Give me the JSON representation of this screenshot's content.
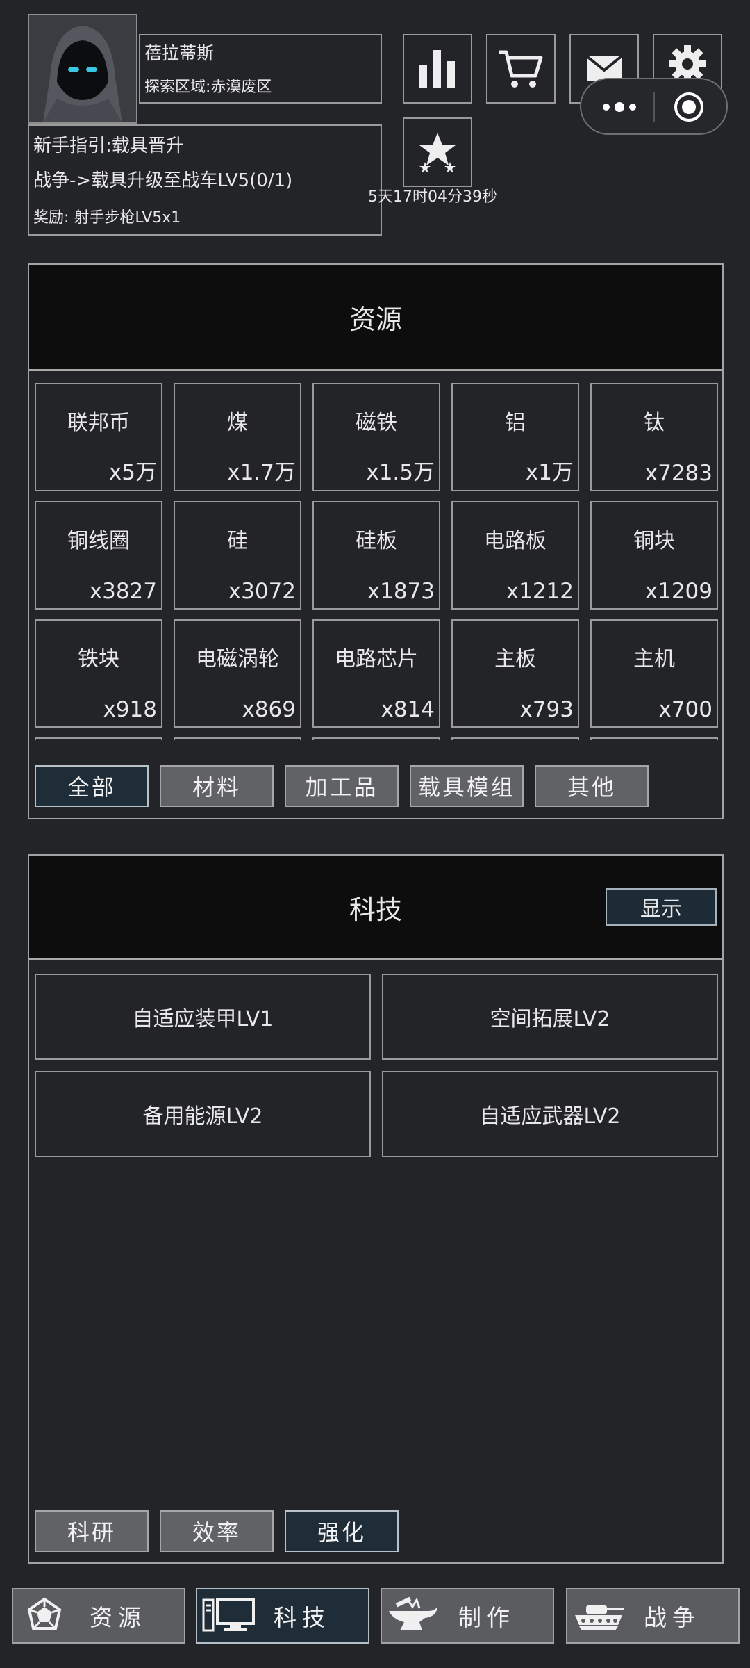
{
  "player": {
    "name": "蓓拉蒂斯",
    "region": "探索区域:赤漠废区"
  },
  "guide": {
    "title": "新手指引:载具晋升",
    "task": "战争->载具升级至战车LV5(0/1)",
    "reward": "奖励: 射手步枪LV5x1"
  },
  "toolbar": {
    "icons": [
      "stats-icon",
      "cart-icon",
      "mail-icon",
      "gear-icon",
      "star-icon"
    ],
    "timer": "5天17时04分39秒"
  },
  "capsule": {
    "icons": [
      "more-dots-icon",
      "record-target-icon"
    ]
  },
  "resources": {
    "title": "资源",
    "items": [
      {
        "name": "联邦币",
        "qty": "x5万"
      },
      {
        "name": "煤",
        "qty": "x1.7万"
      },
      {
        "name": "磁铁",
        "qty": "x1.5万"
      },
      {
        "name": "铝",
        "qty": "x1万"
      },
      {
        "name": "钛",
        "qty": "x7283"
      },
      {
        "name": "铜线圈",
        "qty": "x3827"
      },
      {
        "name": "硅",
        "qty": "x3072"
      },
      {
        "name": "硅板",
        "qty": "x1873"
      },
      {
        "name": "电路板",
        "qty": "x1212"
      },
      {
        "name": "铜块",
        "qty": "x1209"
      },
      {
        "name": "铁块",
        "qty": "x918"
      },
      {
        "name": "电磁涡轮",
        "qty": "x869"
      },
      {
        "name": "电路芯片",
        "qty": "x814"
      },
      {
        "name": "主板",
        "qty": "x793"
      },
      {
        "name": "主机",
        "qty": "x700"
      },
      {
        "name": "",
        "qty": ""
      },
      {
        "name": "",
        "qty": ""
      },
      {
        "name": "",
        "qty": ""
      },
      {
        "name": "",
        "qty": ""
      },
      {
        "name": "",
        "qty": ""
      }
    ],
    "filters": [
      {
        "label": "全部",
        "active": true
      },
      {
        "label": "材料",
        "active": false
      },
      {
        "label": "加工品",
        "active": false
      },
      {
        "label": "载具模组",
        "active": false
      },
      {
        "label": "其他",
        "active": false
      }
    ]
  },
  "tech": {
    "title": "科技",
    "show_label": "显示",
    "items": [
      "自适应装甲LV1",
      "空间拓展LV2",
      "备用能源LV2",
      "自适应武器LV2"
    ],
    "tabs": [
      {
        "label": "科研",
        "active": false
      },
      {
        "label": "效率",
        "active": false
      },
      {
        "label": "强化",
        "active": true
      }
    ]
  },
  "nav": [
    {
      "label": "资源",
      "icon": "dodecahedron-icon",
      "active": false
    },
    {
      "label": "科技",
      "icon": "computer-icon",
      "active": true
    },
    {
      "label": "制作",
      "icon": "anvil-icon",
      "active": false
    },
    {
      "label": "战争",
      "icon": "tank-icon",
      "active": false
    }
  ],
  "colors": {
    "background": "#232427",
    "active_button": "#1f2d38",
    "inactive_button": "#606266",
    "panel_header": "#0d0d0d"
  }
}
